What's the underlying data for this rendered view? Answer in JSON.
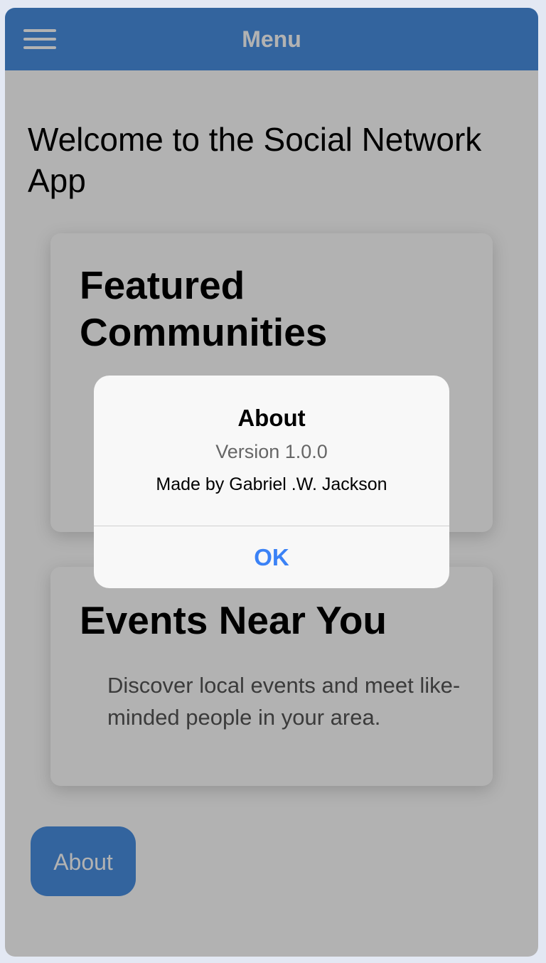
{
  "header": {
    "title": "Menu",
    "menu_icon": "hamburger-menu-icon",
    "background": "#4a90e2"
  },
  "main": {
    "welcome": "Welcome to the Social Network App",
    "cards": [
      {
        "title": "Featured Communities",
        "text": ""
      },
      {
        "title": "Events Near You",
        "text": "Discover local events and meet like-minded people in your area."
      }
    ],
    "about_button": "About"
  },
  "dialog": {
    "title": "About",
    "version": "Version 1.0.0",
    "author": "Made by Gabriel .W. Jackson",
    "ok_label": "OK",
    "accent": "#3b82f6"
  }
}
